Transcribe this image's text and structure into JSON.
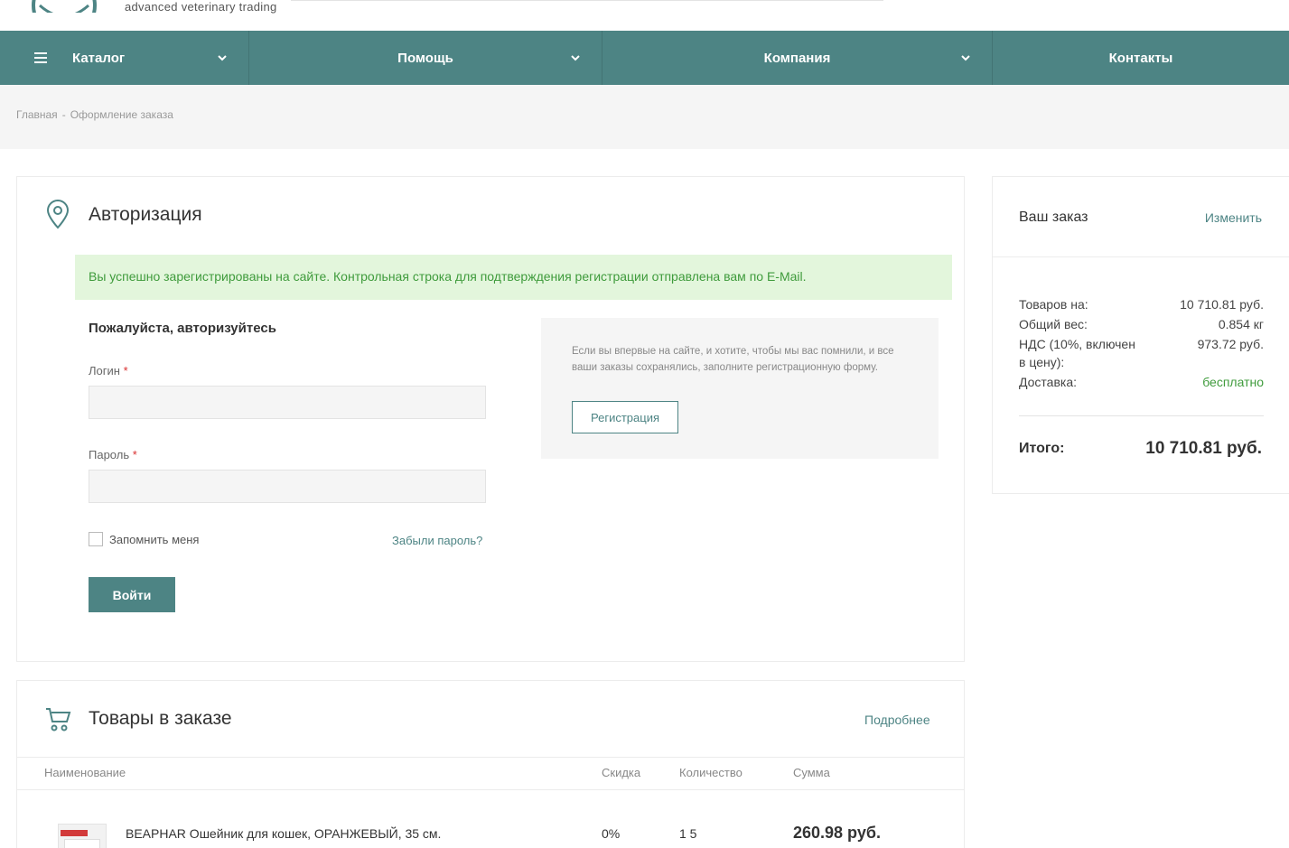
{
  "header": {
    "tagline": "advanced veterinary trading"
  },
  "nav": {
    "items": [
      {
        "label": "Каталог"
      },
      {
        "label": "Помощь"
      },
      {
        "label": "Компания"
      },
      {
        "label": "Контакты"
      }
    ]
  },
  "breadcrumb": {
    "home": "Главная",
    "separator": "-",
    "current": "Оформление заказа"
  },
  "auth": {
    "title": "Авторизация",
    "alert": "Вы успешно зарегистрированы на сайте. Контрольная строка для подтверждения регистрации отправлена вам по E-Mail.",
    "subtitle": "Пожалуйста, авторизуйтесь",
    "login_label": "Логин",
    "login_value": "",
    "password_label": "Пароль",
    "password_value": "",
    "required_mark": "*",
    "remember_label": "Запомнить меня",
    "forgot_label": "Забыли пароль?",
    "submit_label": "Войти",
    "register_text": "Если вы впервые на сайте, и хотите, чтобы мы вас помнили, и все ваши заказы сохранялись, заполните регистрационную форму.",
    "register_label": "Регистрация"
  },
  "order": {
    "title": "Ваш заказ",
    "edit_label": "Изменить",
    "rows": [
      {
        "key": "Товаров на:",
        "value": "10 710.81 руб."
      },
      {
        "key": "Общий вес:",
        "value": "0.854 кг"
      },
      {
        "key": "НДС (10%, включен в цену):",
        "value": "973.72 руб."
      },
      {
        "key": "Доставка:",
        "value": "бесплатно"
      }
    ],
    "total_label": "Итого:",
    "total_value": "10 710.81 руб."
  },
  "goods": {
    "title": "Товары в заказе",
    "more_label": "Подробнее",
    "columns": [
      "Наименование",
      "Скидка",
      "Количество",
      "Сумма"
    ],
    "rows": [
      {
        "name": "BEAPHAR Ошейник для кошек, ОРАНЖЕВЫЙ, 35 см.",
        "discount": "0%",
        "qty": "1 5",
        "sum": "260.98 руб."
      }
    ]
  },
  "colors": {
    "accent": "#4d8484",
    "success_bg": "#e3f6dc",
    "success_text": "#3f9b3c",
    "required": "#d93030"
  }
}
